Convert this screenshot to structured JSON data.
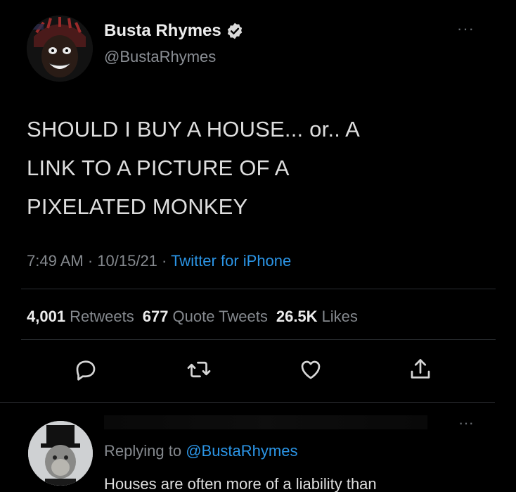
{
  "author": {
    "name": "Busta Rhymes",
    "handle": "@BustaRhymes"
  },
  "tweet": {
    "lines": [
      "SHOULD I BUY A HOUSE... or.. A",
      "LINK TO A PICTURE OF A",
      "PIXELATED MONKEY"
    ],
    "time": "7:49 AM",
    "separator1": " · ",
    "date": "10/15/21",
    "separator2": " · ",
    "source": "Twitter for iPhone"
  },
  "stats": {
    "retweets_count": "4,001",
    "retweets_label": "Retweets",
    "quotes_count": "677",
    "quotes_label": "Quote Tweets",
    "likes_count": "26.5K",
    "likes_label": "Likes"
  },
  "actions": {
    "reply_icon": "reply-icon",
    "retweet_icon": "retweet-icon",
    "like_icon": "heart-icon",
    "share_icon": "share-icon"
  },
  "reply": {
    "replying_prefix": "Replying to ",
    "replying_mention": "@BustaRhymes",
    "text": "Houses are often more of a liability than"
  },
  "colors": {
    "background": "#000000",
    "link": "#2b95e6",
    "muted": "#85898e",
    "verified": "#d9d9d9"
  }
}
